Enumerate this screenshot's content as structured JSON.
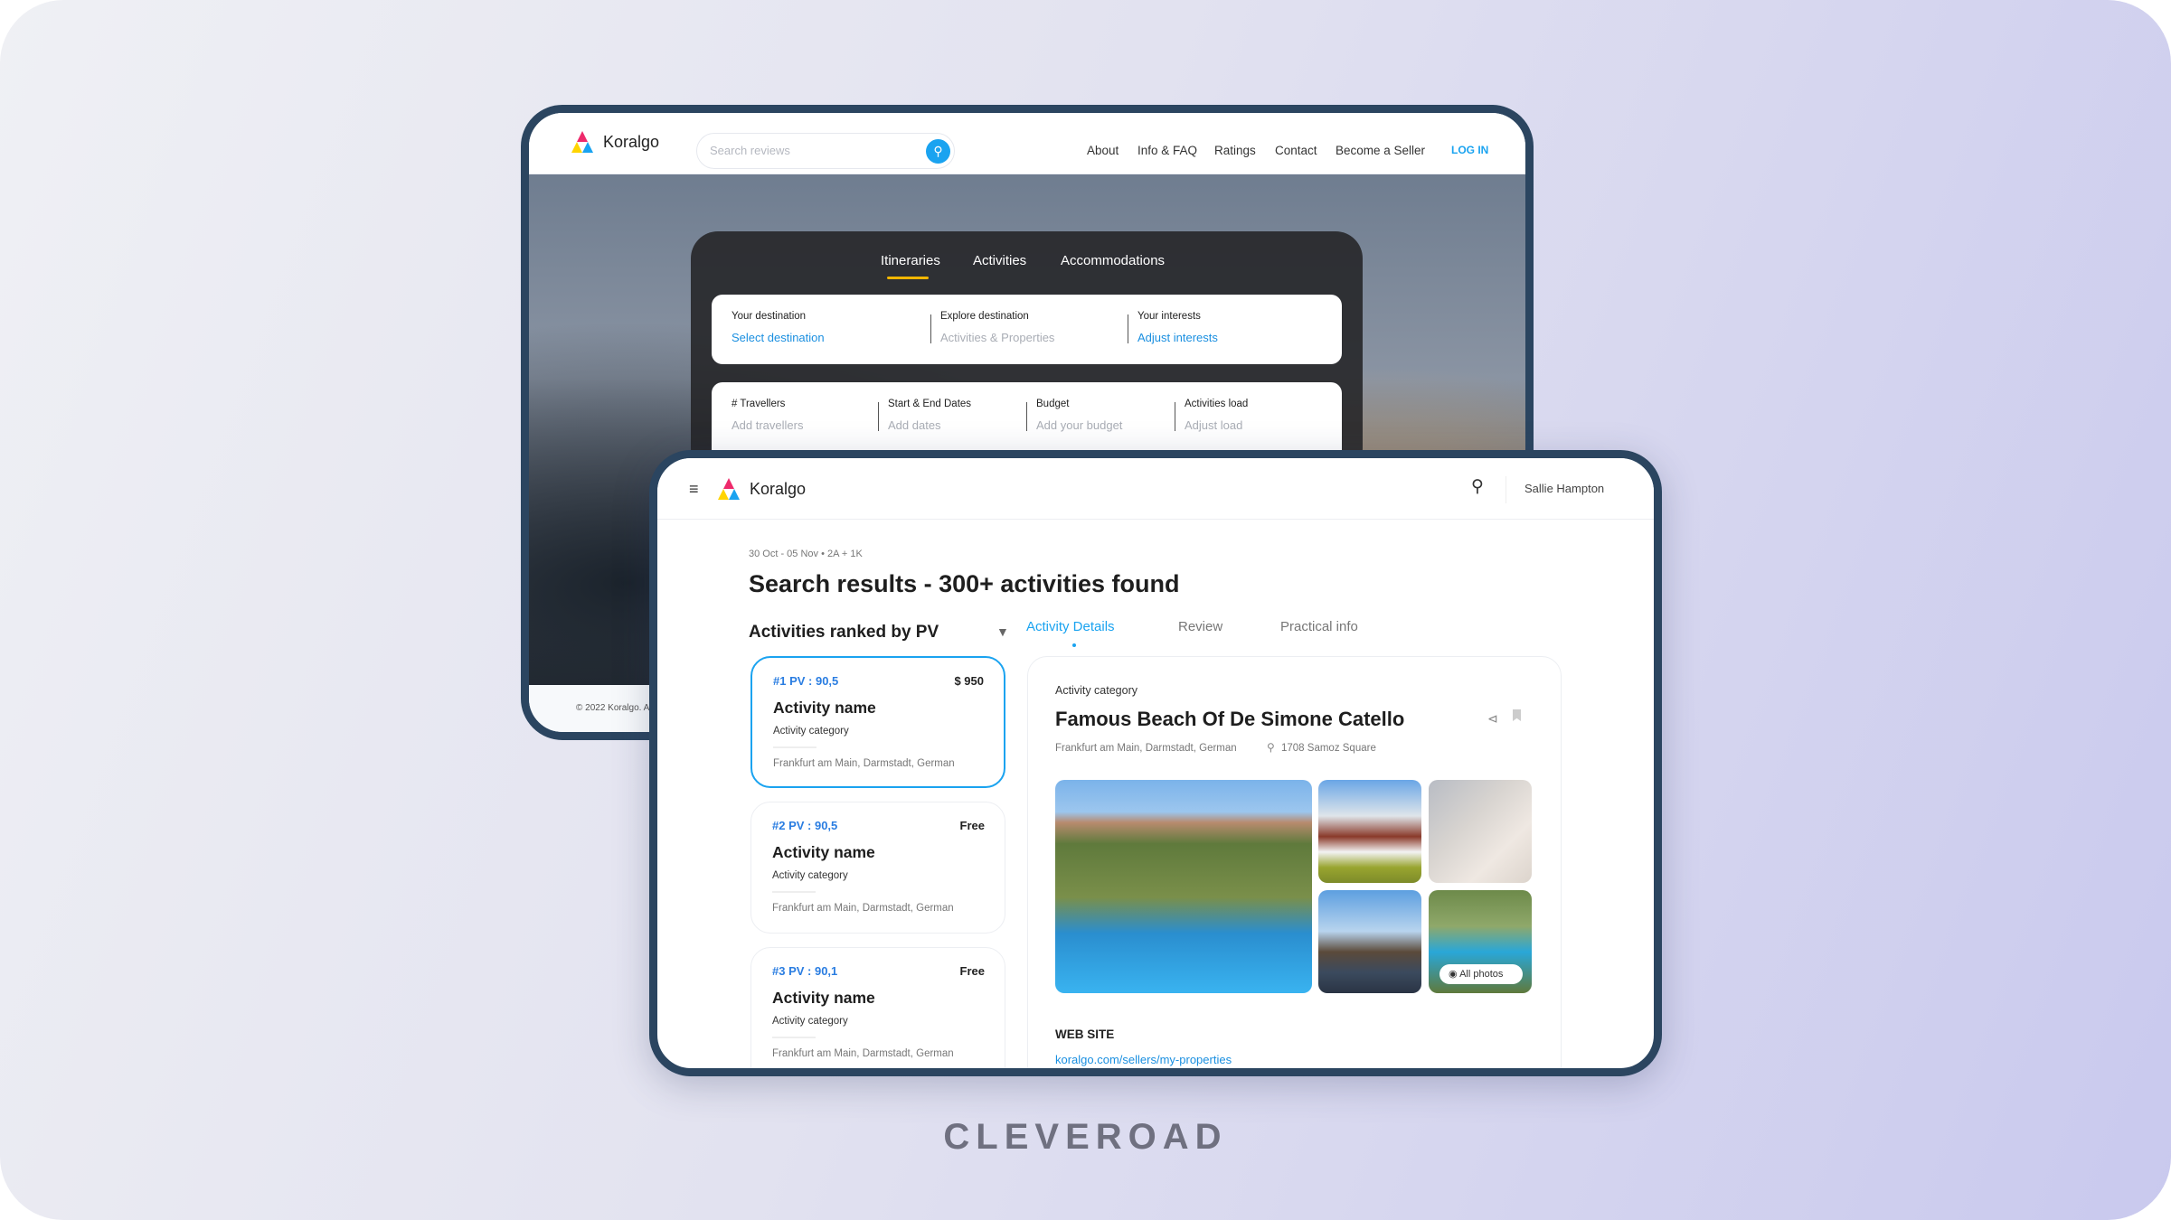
{
  "back": {
    "brand": "Koralgo",
    "search_placeholder": "Search reviews",
    "nav": [
      "About",
      "Info & FAQ",
      "Ratings",
      "Contact",
      "Become a Seller"
    ],
    "login": "LOG IN",
    "tabs": [
      "Itineraries",
      "Activities",
      "Accommodations"
    ],
    "active_tab": "Itineraries",
    "row1": [
      {
        "label": "Your destination",
        "value": "Select destination"
      },
      {
        "label": "Explore destination",
        "value": "Activities & Properties"
      },
      {
        "label": "Your interests",
        "value": "Adjust interests"
      }
    ],
    "row2": [
      {
        "label": "# Travellers",
        "value": "Add travellers"
      },
      {
        "label": "Start & End  Dates",
        "value": "Add dates"
      },
      {
        "label": "Budget",
        "value": "Add your budget"
      },
      {
        "label": "Activities load",
        "value": "Adjust load"
      }
    ],
    "footer": "© 2022 Koralgo. A"
  },
  "front": {
    "brand": "Koralgo",
    "user": "Sallie Hampton",
    "meta_dates": "30 Oct - 05 Nov",
    "meta_guests": "2A + 1K",
    "title": "Search results - 300+ activities found",
    "list_title": "Activities ranked by PV",
    "tabs": [
      "Activity Details",
      "Review",
      "Practical info"
    ],
    "active_tab": "Activity Details",
    "cards": [
      {
        "rank": "#1 PV : 90,5",
        "price": "$ 950",
        "name": "Activity name",
        "category": "Activity category",
        "location": "Frankfurt am Main, Darmstadt, German"
      },
      {
        "rank": "#2 PV : 90,5",
        "price": "Free",
        "name": "Activity name",
        "category": "Activity category",
        "location": "Frankfurt am Main, Darmstadt, German"
      },
      {
        "rank": "#3 PV : 90,1",
        "price": "Free",
        "name": "Activity name",
        "category": "Activity category",
        "location": "Frankfurt am Main, Darmstadt, German"
      }
    ],
    "detail": {
      "category": "Activity category",
      "title": "Famous Beach Of De Simone Catello",
      "location": "Frankfurt am Main, Darmstadt, German",
      "address": "1708 Samoz Square",
      "all_photos": "All photos",
      "website_label": "WEB SITE",
      "website": "koralgo.com/sellers/my-properties"
    }
  },
  "watermark": "CLEVEROAD",
  "colors": {
    "accent": "#1aa3f0",
    "link": "#2a7de1",
    "frame": "#2b4560",
    "tab_underline": "#f2b600"
  }
}
